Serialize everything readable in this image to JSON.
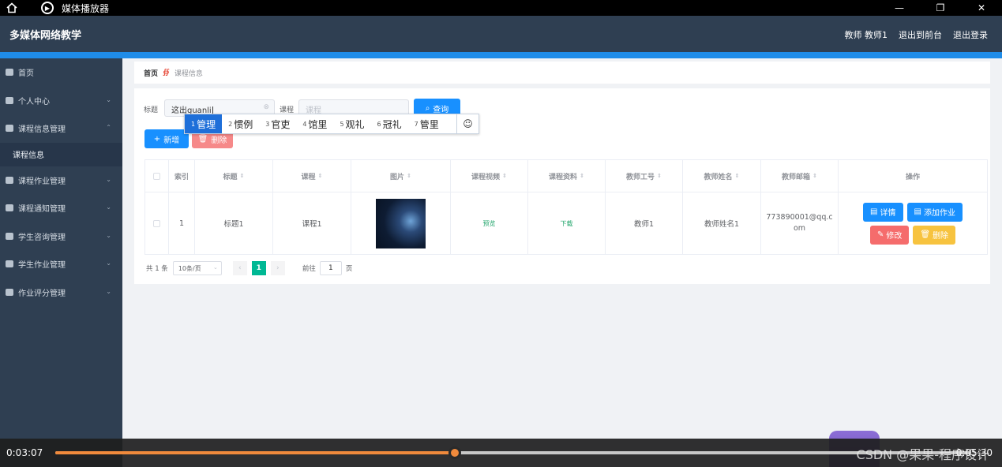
{
  "window": {
    "title": "媒体播放器",
    "controls": [
      "—",
      "❐",
      "✕"
    ]
  },
  "app": {
    "title": "多媒体网络教学",
    "user": "教师 教师1",
    "back": "退出到前台",
    "logout": "退出登录"
  },
  "sidebar": {
    "items": [
      {
        "label": "首页"
      },
      {
        "label": "个人中心"
      },
      {
        "label": "课程信息管理"
      },
      {
        "label": "课程作业管理"
      },
      {
        "label": "课程通知管理"
      },
      {
        "label": "学生咨询管理"
      },
      {
        "label": "学生作业管理"
      },
      {
        "label": "作业评分管理"
      }
    ],
    "sub": "课程信息"
  },
  "breadcrumb": {
    "home": "首页",
    "sep": "∯",
    "current": "课程信息"
  },
  "search": {
    "title_label": "标题",
    "title_value": "这出guanli",
    "course_label": "课程",
    "course_placeholder": "课程",
    "query_label": "查询",
    "add_label": "新增",
    "delete_label": "删除"
  },
  "ime": {
    "candidates": [
      {
        "n": "1",
        "t": "管理"
      },
      {
        "n": "2",
        "t": "惯例"
      },
      {
        "n": "3",
        "t": "官吏"
      },
      {
        "n": "4",
        "t": "馆里"
      },
      {
        "n": "5",
        "t": "观礼"
      },
      {
        "n": "6",
        "t": "冠礼"
      },
      {
        "n": "7",
        "t": "管里"
      }
    ],
    "emoji": "☺"
  },
  "table": {
    "headers": [
      "索引",
      "标题",
      "课程",
      "图片",
      "课程视频",
      "课程资料",
      "教师工号",
      "教师姓名",
      "教师邮箱",
      "操作"
    ],
    "row": {
      "index": "1",
      "title": "标题1",
      "course": "课程1",
      "video": "预览",
      "material": "下载",
      "teacher_id": "教师1",
      "teacher_name": "教师姓名1",
      "email": "773890001@qq.com"
    },
    "actions": {
      "detail": "详情",
      "add_homework": "添加作业",
      "edit": "修改",
      "delete": "删除"
    }
  },
  "pager": {
    "total": "共 1 条",
    "size": "10条/页",
    "current": "1",
    "goto": "前往",
    "goto_value": "1",
    "unit": "页"
  },
  "player": {
    "time": "0:03:07",
    "end": "0:05:30",
    "progress": 0.436
  },
  "watermark": "CSDN @果果-程序设计",
  "colors": {
    "primary": "#1890ff",
    "danger": "#f56c6c",
    "warning": "#f7c33f",
    "sidebar": "#2f3f52",
    "accent": "#f08a3c"
  }
}
